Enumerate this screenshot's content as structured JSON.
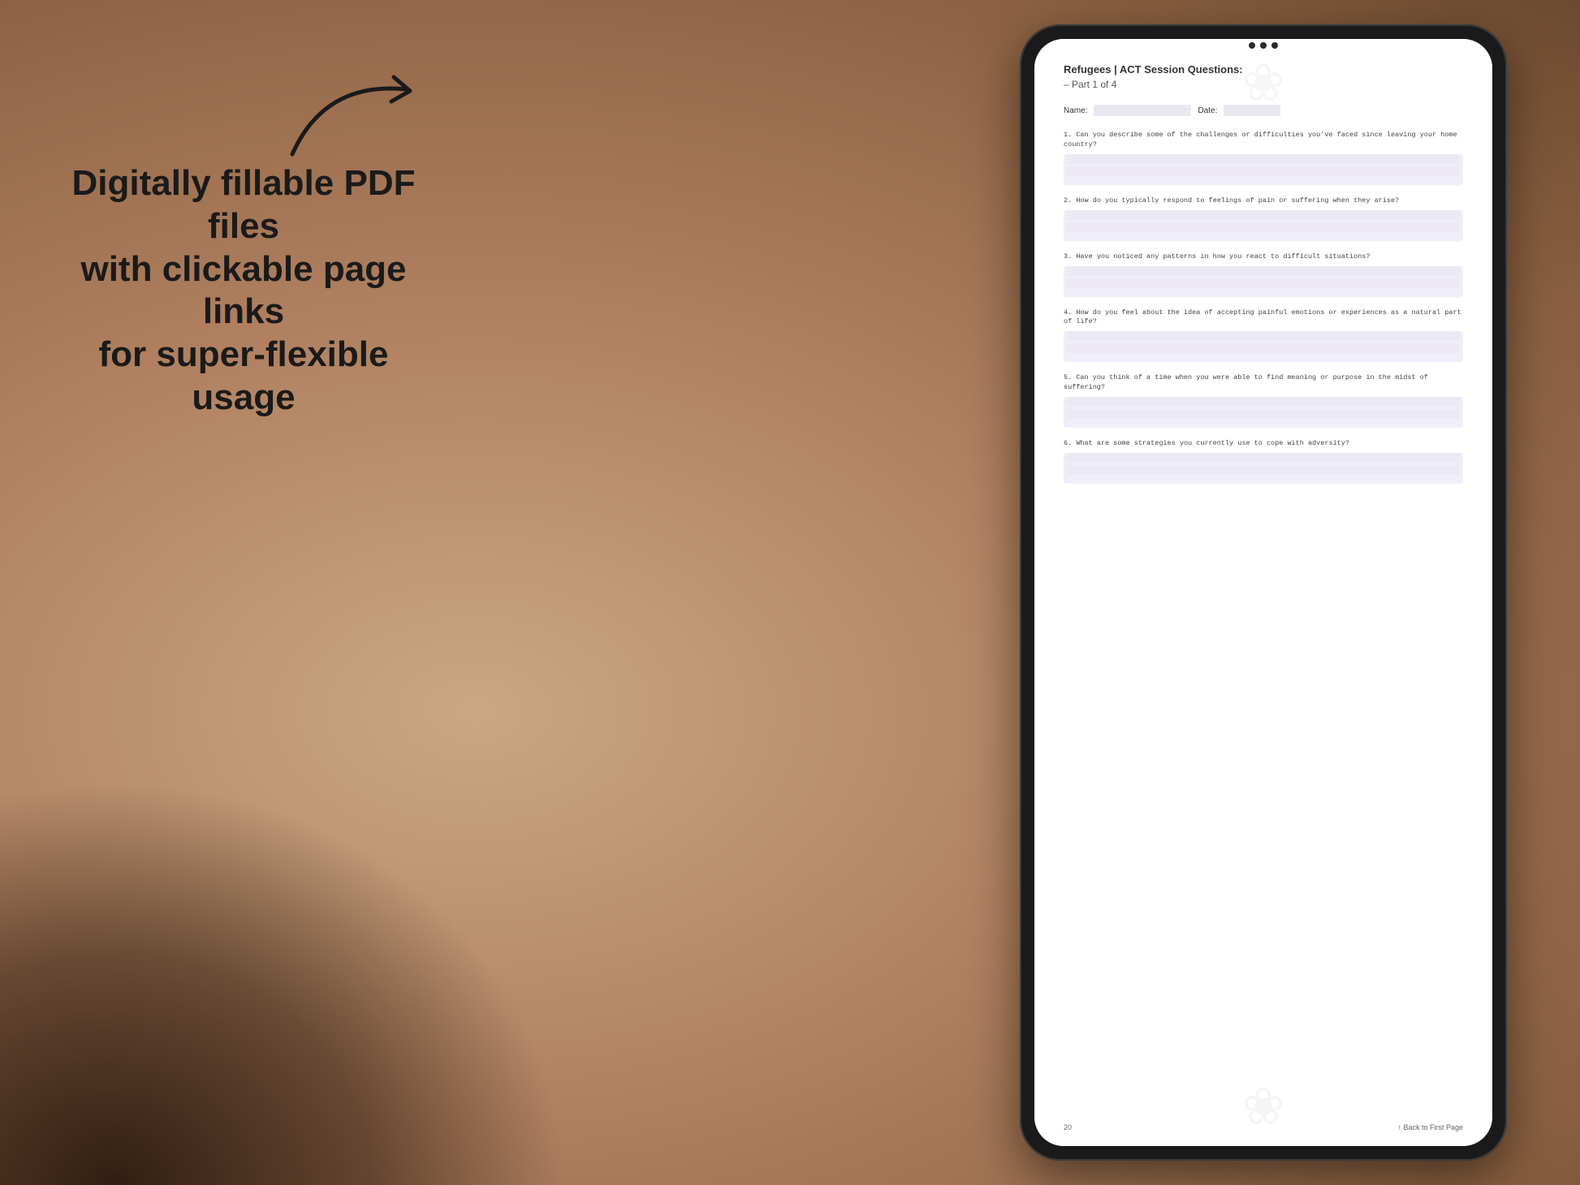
{
  "background": {
    "color_left": "#b08060",
    "color_right": "#8a6040"
  },
  "marketing": {
    "line1": "Digitally fillable PDF files",
    "line2": "with clickable page links",
    "line3": "for super-flexible usage"
  },
  "arrow": {
    "description": "curved arrow pointing right toward tablet"
  },
  "document": {
    "title": "Refugees | ACT Session Questions:",
    "subtitle": "– Part 1 of 4",
    "name_label": "Name:",
    "date_label": "Date:",
    "questions": [
      {
        "number": "1.",
        "text": "Can you describe some of the challenges or difficulties you've faced since leaving your home country?"
      },
      {
        "number": "2.",
        "text": "How do you typically respond to feelings of pain or suffering when they arise?"
      },
      {
        "number": "3.",
        "text": "Have you noticed any patterns in how you react to difficult situations?"
      },
      {
        "number": "4.",
        "text": "How do you feel about the idea of accepting painful emotions or experiences as a natural part of life?"
      },
      {
        "number": "5.",
        "text": "Can you think of a time when you were able to find meaning or purpose in the midst of suffering?"
      },
      {
        "number": "6.",
        "text": "What are some strategies you currently use to cope with adversity?"
      }
    ],
    "footer": {
      "page_number": "20",
      "back_link": "↑ Back to First Page"
    }
  },
  "tablet": {
    "border_color": "#1a1a1a"
  }
}
